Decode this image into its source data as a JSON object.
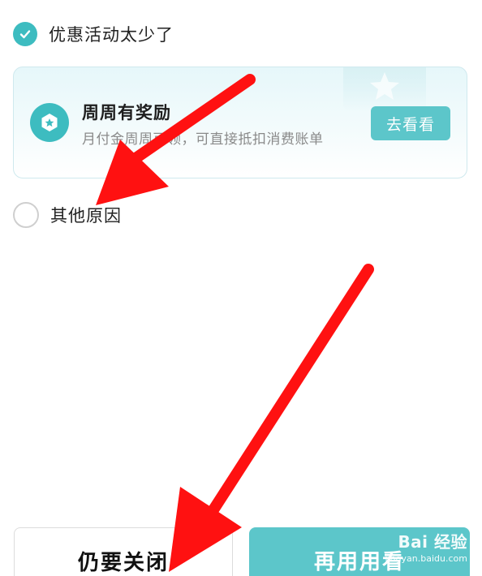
{
  "options": {
    "checked_label": "优惠活动太少了",
    "other_label": "其他原因"
  },
  "reward_card": {
    "title": "周周有奖励",
    "subtitle": "月付金周周可领，可直接抵扣消费账单",
    "button_label": "去看看"
  },
  "footer": {
    "close_label": "仍要关闭",
    "continue_label": "再用用看"
  },
  "watermark": {
    "brand": "Bai 经验",
    "url": "jingyan.baidu.com"
  },
  "colors": {
    "accent": "#3dbcc0",
    "button_teal": "#5cc6ca",
    "annotation_red": "#ff1111"
  }
}
